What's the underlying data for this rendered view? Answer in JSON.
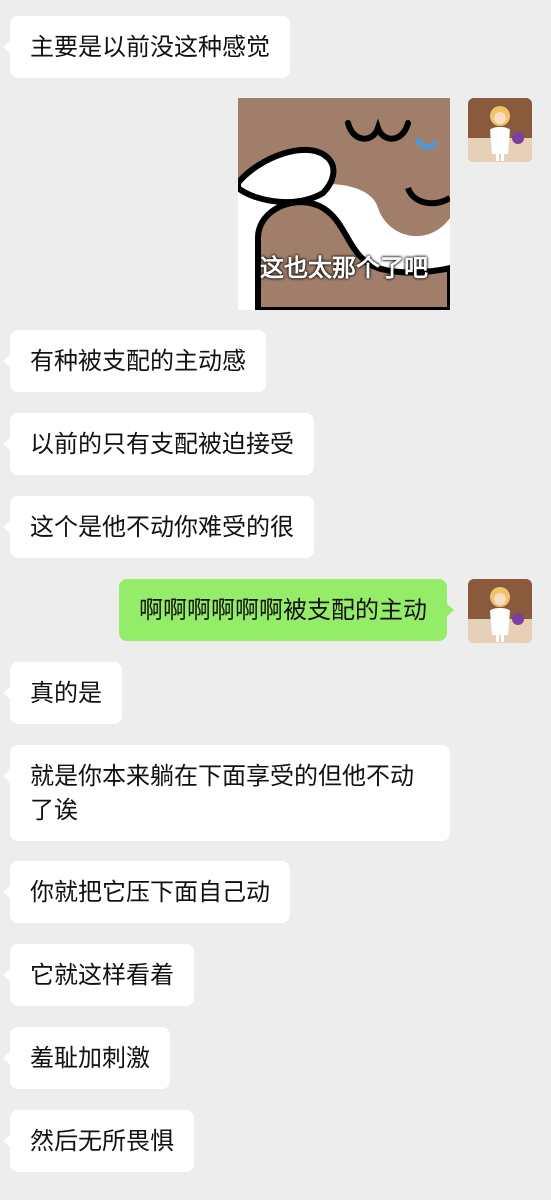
{
  "messages": [
    {
      "side": "in",
      "text": "主要是以前没这种感觉"
    },
    {
      "side": "out",
      "type": "sticker",
      "caption": "这也太那个了吧"
    },
    {
      "side": "in",
      "text": "有种被支配的主动感"
    },
    {
      "side": "in",
      "text": "以前的只有支配被迫接受"
    },
    {
      "side": "in",
      "text": "这个是他不动你难受的很"
    },
    {
      "side": "out",
      "text": "啊啊啊啊啊啊被支配的主动"
    },
    {
      "side": "in",
      "text": "真的是"
    },
    {
      "side": "in",
      "text": "就是你本来躺在下面享受的但他不动了诶"
    },
    {
      "side": "in",
      "text": "你就把它压下面自己动"
    },
    {
      "side": "in",
      "text": "它就这样看着"
    },
    {
      "side": "in",
      "text": "羞耻加刺激"
    },
    {
      "side": "in",
      "text": "然后无所畏惧"
    }
  ],
  "avatars": {
    "self": "anime-character-avatar"
  },
  "colors": {
    "background": "#ededed",
    "incoming_bubble": "#ffffff",
    "outgoing_bubble": "#95ec69",
    "text": "#111111"
  }
}
